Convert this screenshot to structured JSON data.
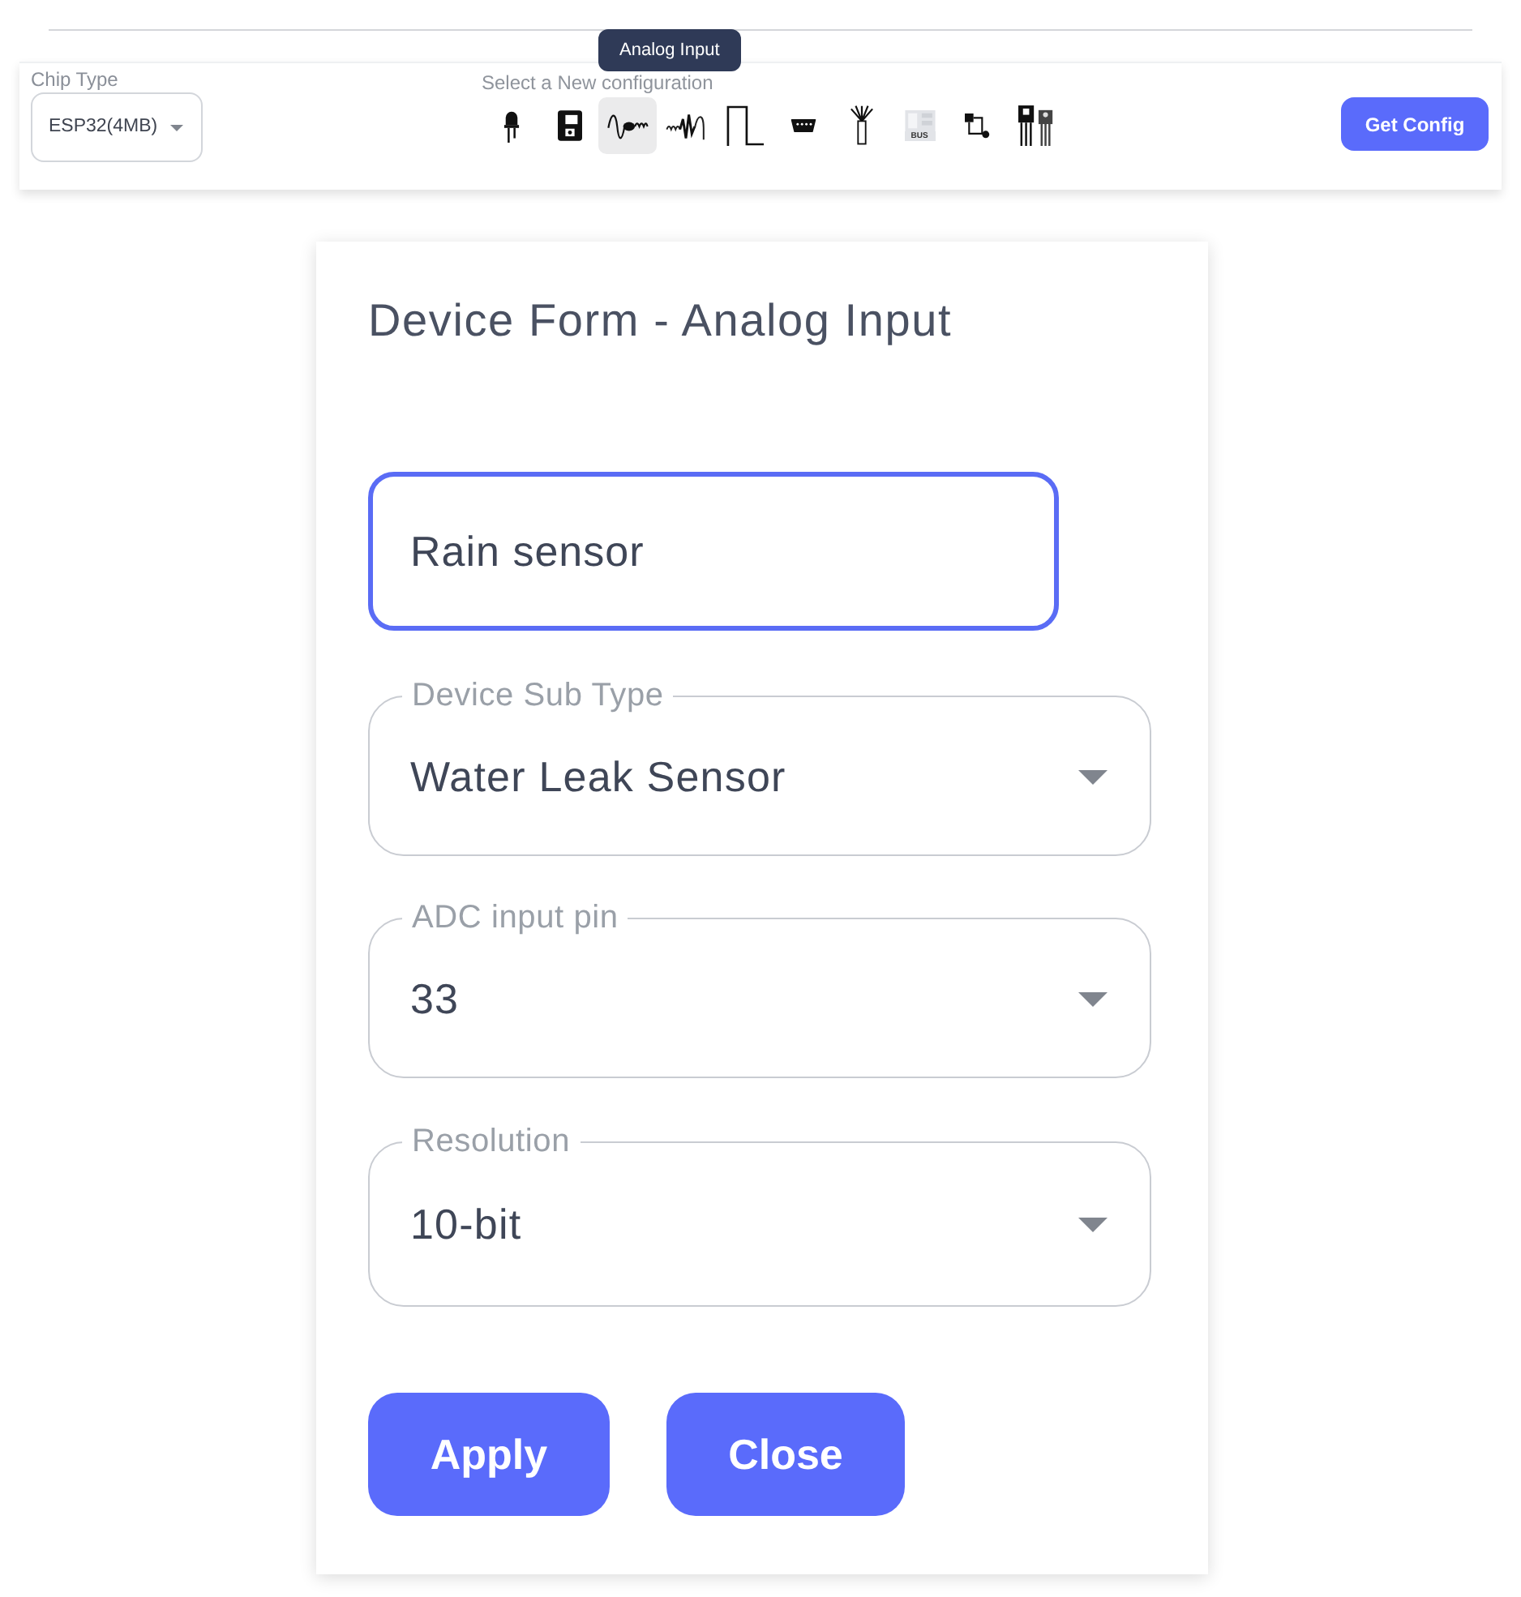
{
  "top_bar": {
    "chip_type": {
      "label": "Chip Type",
      "value": "ESP32(4MB)"
    },
    "configuration": {
      "label": "Select a New configuration",
      "tooltip": "Analog Input",
      "device_types": [
        {
          "kind": "led",
          "selected": false
        },
        {
          "kind": "module",
          "selected": false
        },
        {
          "kind": "analog",
          "selected": true
        },
        {
          "kind": "signal",
          "selected": false
        },
        {
          "kind": "pulse",
          "selected": false
        },
        {
          "kind": "connector",
          "selected": false
        },
        {
          "kind": "cable",
          "selected": false
        },
        {
          "kind": "bus",
          "label": "BUS",
          "selected": false
        },
        {
          "kind": "path",
          "selected": false
        },
        {
          "kind": "transistor",
          "selected": false
        }
      ]
    },
    "get_config_button": "Get Config"
  },
  "form": {
    "title": "Device Form - Analog Input",
    "name_field": {
      "value": "Rain sensor",
      "focused": true
    },
    "selects": [
      {
        "label": "Device Sub Type",
        "value": "Water Leak Sensor"
      },
      {
        "label": "ADC input pin",
        "value": "33"
      },
      {
        "label": "Resolution",
        "value": "10-bit"
      }
    ],
    "buttons": [
      "Apply",
      "Close"
    ]
  }
}
